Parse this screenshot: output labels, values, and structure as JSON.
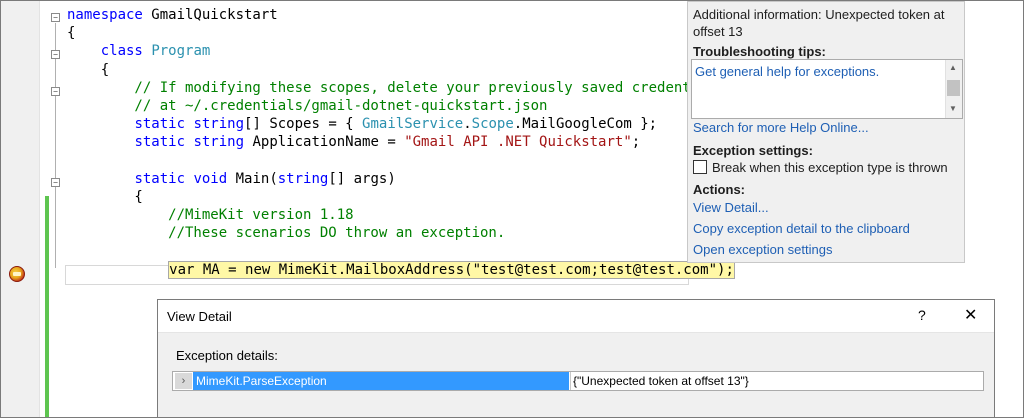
{
  "code": {
    "lines": [
      {
        "parts": [
          {
            "c": "kw",
            "t": "namespace"
          },
          {
            "c": "pl",
            "t": " GmailQuickstart"
          }
        ]
      },
      {
        "parts": [
          {
            "c": "pl",
            "t": "{"
          }
        ]
      },
      {
        "parts": [
          {
            "c": "pl",
            "t": "    "
          },
          {
            "c": "kw",
            "t": "class"
          },
          {
            "c": "pl",
            "t": " "
          },
          {
            "c": "ty",
            "t": "Program"
          }
        ]
      },
      {
        "parts": [
          {
            "c": "pl",
            "t": "    {"
          }
        ]
      },
      {
        "parts": [
          {
            "c": "cm",
            "t": "        // If modifying these scopes, delete your previously saved credentials"
          }
        ]
      },
      {
        "parts": [
          {
            "c": "cm",
            "t": "        // at ~/.credentials/gmail-dotnet-quickstart.json"
          }
        ]
      },
      {
        "parts": [
          {
            "c": "pl",
            "t": "        "
          },
          {
            "c": "kw",
            "t": "static"
          },
          {
            "c": "pl",
            "t": " "
          },
          {
            "c": "kw",
            "t": "string"
          },
          {
            "c": "pl",
            "t": "[] Scopes = { "
          },
          {
            "c": "ty",
            "t": "GmailService"
          },
          {
            "c": "pl",
            "t": "."
          },
          {
            "c": "ty",
            "t": "Scope"
          },
          {
            "c": "pl",
            "t": ".MailGoogleCom };"
          }
        ]
      },
      {
        "parts": [
          {
            "c": "pl",
            "t": "        "
          },
          {
            "c": "kw",
            "t": "static"
          },
          {
            "c": "pl",
            "t": " "
          },
          {
            "c": "kw",
            "t": "string"
          },
          {
            "c": "pl",
            "t": " ApplicationName = "
          },
          {
            "c": "st",
            "t": "\"Gmail API .NET Quickstart\""
          },
          {
            "c": "pl",
            "t": ";"
          }
        ]
      },
      {
        "parts": [
          {
            "c": "pl",
            "t": ""
          }
        ]
      },
      {
        "parts": [
          {
            "c": "pl",
            "t": "        "
          },
          {
            "c": "kw",
            "t": "static"
          },
          {
            "c": "pl",
            "t": " "
          },
          {
            "c": "kw",
            "t": "void"
          },
          {
            "c": "pl",
            "t": " Main("
          },
          {
            "c": "kw",
            "t": "string"
          },
          {
            "c": "pl",
            "t": "[] args)"
          }
        ]
      },
      {
        "parts": [
          {
            "c": "pl",
            "t": "        {"
          }
        ]
      },
      {
        "parts": [
          {
            "c": "cm",
            "t": "            //MimeKit version 1.18"
          }
        ]
      },
      {
        "parts": [
          {
            "c": "cm",
            "t": "            //These scenarios DO throw an exception."
          }
        ]
      },
      {
        "parts": [
          {
            "c": "pl",
            "t": ""
          }
        ]
      },
      {
        "parts": [
          {
            "c": "pl",
            "t": "            "
          },
          {
            "c": "hl",
            "t": "var MA = new MimeKit.MailboxAddress(\"test@test.com;test@test.com\");"
          }
        ]
      }
    ]
  },
  "exception_panel": {
    "additional_info": "Additional information: Unexpected token at offset 13",
    "tips_title": "Troubleshooting tips:",
    "tips_link": "Get general help for exceptions.",
    "search_link": "Search for more Help Online...",
    "settings_title": "Exception settings:",
    "break_checkbox_label": "Break when this exception type is thrown",
    "break_checked": false,
    "actions_title": "Actions:",
    "action_view_detail": "View Detail...",
    "action_copy": "Copy exception detail to the clipboard",
    "action_open_settings": "Open exception settings"
  },
  "dialog": {
    "title": "View Detail",
    "help_glyph": "?",
    "close_glyph": "✕",
    "details_label": "Exception details:",
    "row_expander": "›",
    "row_name": "MimeKit.ParseException",
    "row_value": "{\"Unexpected token at offset 13\"}"
  }
}
